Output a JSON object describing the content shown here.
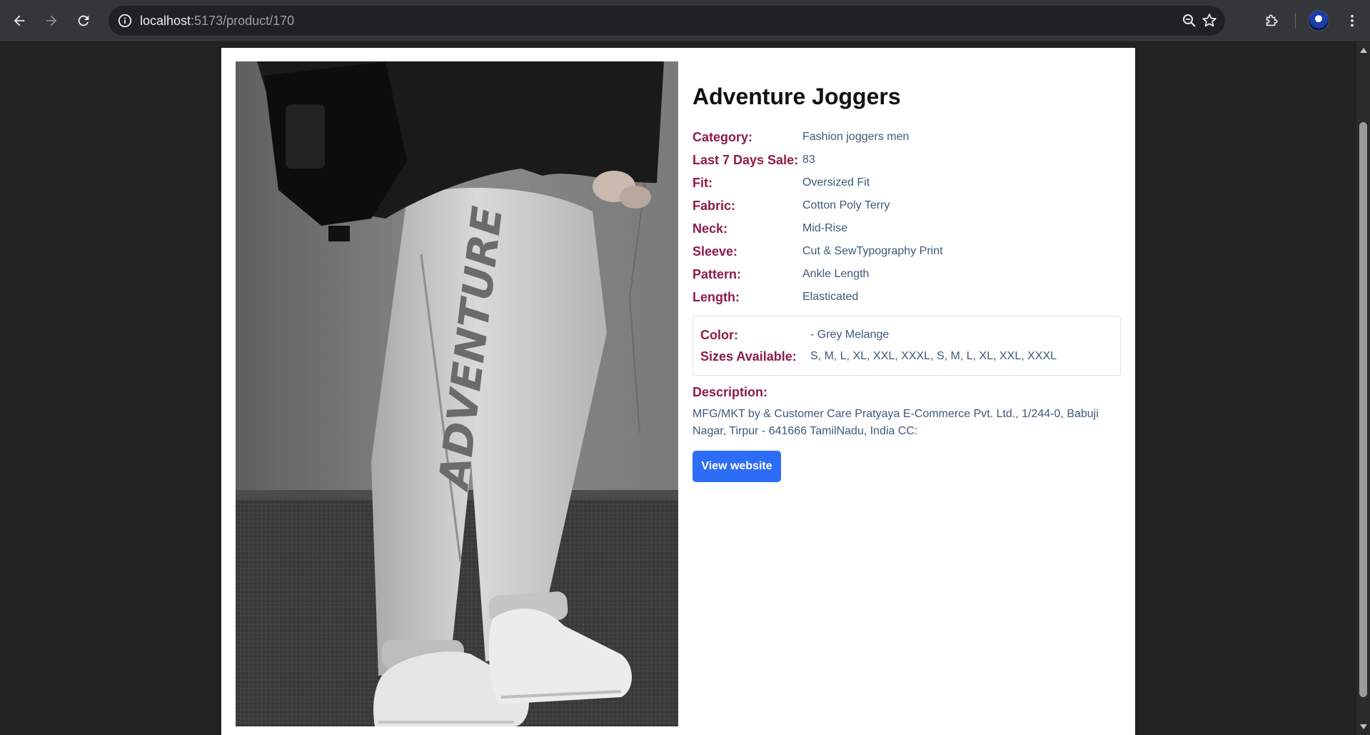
{
  "browser": {
    "url_host": "localhost",
    "url_path": ":5173/product/170"
  },
  "product": {
    "title": "Adventure Joggers",
    "image_text": "ADVENTURE",
    "specs": [
      {
        "label": "Category:",
        "value": "Fashion joggers men"
      },
      {
        "label": "Last 7 Days Sale:",
        "value": "83"
      },
      {
        "label": "Fit:",
        "value": "Oversized Fit"
      },
      {
        "label": "Fabric:",
        "value": "Cotton Poly Terry"
      },
      {
        "label": "Neck:",
        "value": "Mid-Rise"
      },
      {
        "label": "Sleeve:",
        "value": "Cut & SewTypography Print"
      },
      {
        "label": "Pattern:",
        "value": "Ankle Length"
      },
      {
        "label": "Length:",
        "value": "Elasticated"
      }
    ],
    "variants": {
      "color_label": "Color:",
      "color_value": "- Grey Melange",
      "sizes_label": "Sizes Available:",
      "sizes_value": "S, M, L, XL, XXL, XXXL, S, M, L, XL, XXL, XXXL"
    },
    "description_label": "Description:",
    "description": "MFG/MKT by & Customer Care Pratyaya E-Commerce Pvt. Ltd., 1/244-0, Babuji Nagar, Tirpur - 641666 TamilNadu, India CC:",
    "view_button_label": "View website"
  },
  "colors": {
    "label": "#8e1b4c",
    "value": "#3d5a7a",
    "button": "#2d6df6"
  }
}
